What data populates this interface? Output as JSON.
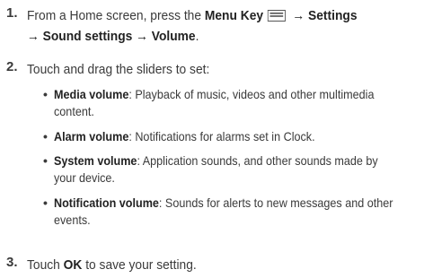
{
  "steps": [
    {
      "number": "1.",
      "line1_prefix": "From a Home screen, press the ",
      "menu_key_label": "Menu Key",
      "menu_key_icon": "menu-key-icon",
      "line1_suffix": " → Settings",
      "line2": "→ Sound settings → Volume",
      "line2_end": "."
    },
    {
      "number": "2.",
      "text": "Touch and drag the sliders to set:"
    },
    {
      "number": "3.",
      "text_prefix": "Touch ",
      "ok_label": "OK",
      "text_suffix": " to save your setting."
    }
  ],
  "bullets": [
    {
      "bullet": "•",
      "label": "Media volume",
      "desc_line1": ": Playback of music, videos and other multimedia",
      "desc_line2": "content."
    },
    {
      "bullet": "•",
      "label": "Alarm volume",
      "desc_line1": ": Notifications for alarms set in Clock.",
      "desc_line2": ""
    },
    {
      "bullet": "•",
      "label": "System volume",
      "desc_line1": ": Application sounds, and other sounds made by",
      "desc_line2": "your device."
    },
    {
      "bullet": "•",
      "label": "Notification volume",
      "desc_line1": ": Sounds for alerts to new messages and other",
      "desc_line2": "events."
    }
  ]
}
